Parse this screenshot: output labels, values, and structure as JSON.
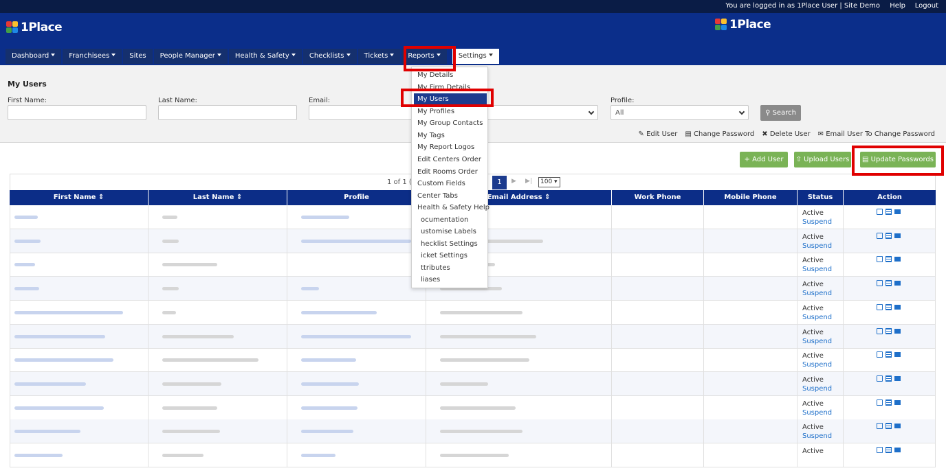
{
  "topbar": {
    "logged_in": "You are logged in as  1Place User | Site Demo",
    "help": "Help",
    "logout": "Logout"
  },
  "brand": {
    "name": "1Place"
  },
  "nav": [
    {
      "label": "Dashboard",
      "caret": true
    },
    {
      "label": "Franchisees",
      "caret": true
    },
    {
      "label": "Sites",
      "caret": false
    },
    {
      "label": "People Manager",
      "caret": true
    },
    {
      "label": "Health & Safety",
      "caret": true
    },
    {
      "label": "Checklists",
      "caret": true
    },
    {
      "label": "Tickets",
      "caret": true
    },
    {
      "label": "Reports",
      "caret": true
    },
    {
      "label": "Settings",
      "caret": true
    }
  ],
  "page": {
    "title": "My Users"
  },
  "filters": {
    "first_name": "First Name:",
    "last_name": "Last Name:",
    "email": "Email:",
    "profile": "Profile:",
    "profile_value": "All",
    "search": "Search"
  },
  "legend": {
    "edit": "Edit User",
    "change_password": "Change Password",
    "delete": "Delete User",
    "email": "Email User To Change Password"
  },
  "buttons": {
    "add_user": "Add User",
    "upload_users": "Upload Users",
    "update_passwords": "Update Passwords"
  },
  "pager": {
    "info": "1 of 1 (",
    "page": "1",
    "per_page": "100"
  },
  "table": {
    "headers": [
      "First Name ⇕",
      "Last Name ⇕",
      "Profile",
      "Email Address ⇕",
      "Work Phone",
      "Mobile Phone",
      "Status",
      "Action"
    ],
    "status_active": "Active",
    "status_action": "Suspend"
  },
  "settings_menu": [
    "My Details",
    "My Firm Details",
    "My Users",
    "My Profiles",
    "My Group Contacts",
    "My Tags",
    "My Report Logos",
    "Edit Centers Order",
    "Edit Rooms Order",
    "Custom Fields",
    "Center Tabs",
    "Health & Safety Help",
    "ocumentation",
    "ustomise Labels",
    "hecklist Settings",
    "icket Settings",
    "ttributes",
    "liases"
  ],
  "colors": {
    "navy": "#0b2e8a",
    "highlight": "#e00000",
    "green": "#7ab356",
    "link": "#1e6fc9"
  }
}
